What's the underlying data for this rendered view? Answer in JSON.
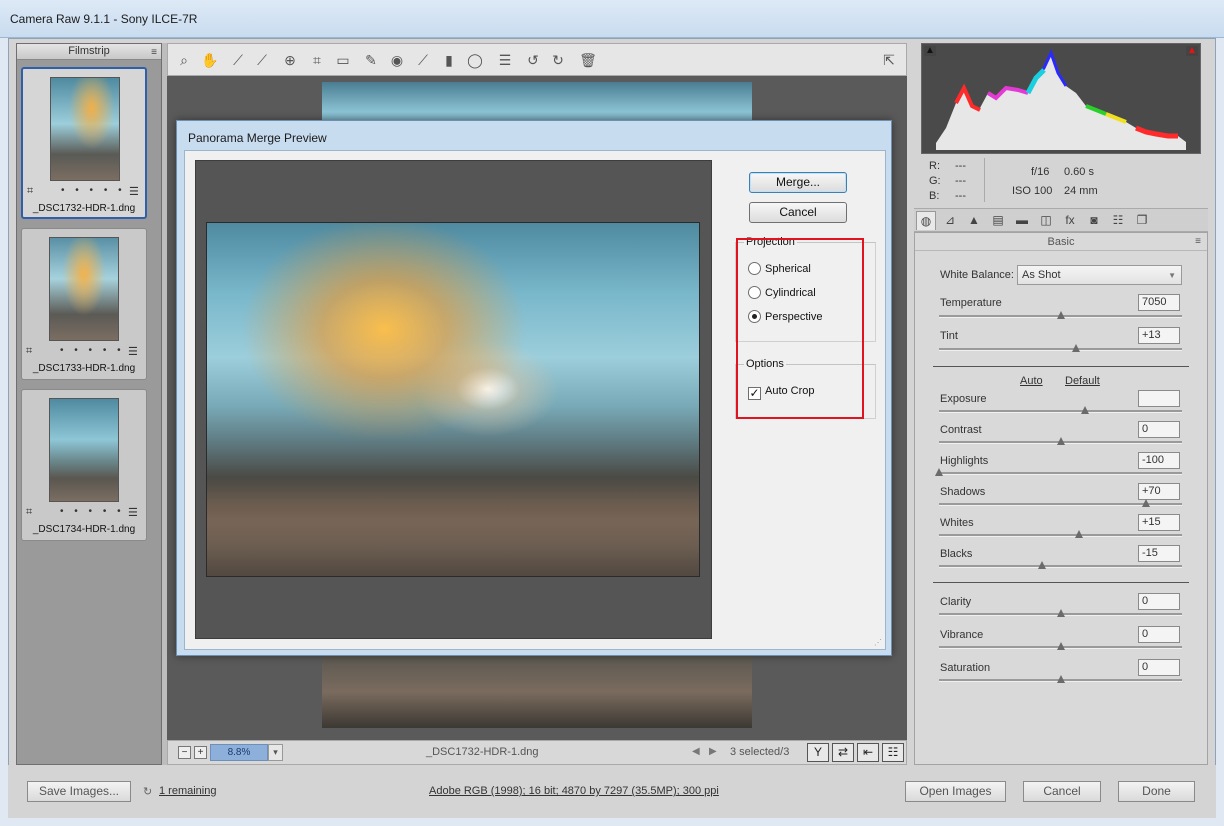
{
  "window": {
    "title": "Camera Raw 9.1.1  -  Sony ILCE-7R"
  },
  "filmstrip": {
    "header": "Filmstrip",
    "items": [
      {
        "name": "_DSC1732-HDR-1.dng",
        "dots": "• • • • •",
        "selected": true
      },
      {
        "name": "_DSC1733-HDR-1.dng",
        "dots": "• • • • •",
        "selected": false
      },
      {
        "name": "_DSC1734-HDR-1.dng",
        "dots": "• • • • •",
        "selected": false
      }
    ]
  },
  "toolbar": {
    "icons": [
      "zoom-icon",
      "hand-icon",
      "white-balance-icon",
      "color-sampler-icon",
      "target-adjust-icon",
      "crop-icon",
      "straighten-icon",
      "spot-removal-icon",
      "red-eye-icon",
      "adjustment-brush-icon",
      "graduated-filter-icon",
      "radial-filter-icon",
      "presets-list-icon",
      "rotate-left-icon",
      "rotate-right-icon",
      "trash-icon",
      "open-preferences-icon"
    ]
  },
  "statusbar": {
    "zoom": "8.8%",
    "filename": "_DSC1732-HDR-1.dng",
    "selected": "3 selected/3"
  },
  "dialog": {
    "title": "Panorama Merge Preview",
    "merge_label": "Merge...",
    "cancel_label": "Cancel",
    "projection": {
      "label": "Projection",
      "options": [
        "Spherical",
        "Cylindrical",
        "Perspective"
      ],
      "selected": "Perspective"
    },
    "options": {
      "label": "Options",
      "auto_crop": "Auto Crop",
      "auto_crop_checked": true
    }
  },
  "info": {
    "r": "R:",
    "g": "G:",
    "b": "B:",
    "r_val": "---",
    "g_val": "---",
    "b_val": "---",
    "aperture": "f/16",
    "shutter": "0.60 s",
    "iso": "ISO 100",
    "focal": "24 mm"
  },
  "panel": {
    "title": "Basic",
    "white_balance": {
      "label": "White Balance:",
      "value": "As Shot"
    },
    "temperature": {
      "label": "Temperature",
      "value": "7050",
      "level": 0.5
    },
    "tint": {
      "label": "Tint",
      "value": "+13",
      "level": 0.565
    },
    "auto_label": "Auto",
    "default_label": "Default",
    "tone": [
      {
        "label": "Exposure",
        "value": "",
        "level": 0.6
      },
      {
        "label": "Contrast",
        "value": "0",
        "level": 0.5
      },
      {
        "label": "Highlights",
        "value": "-100",
        "level": 0.0
      },
      {
        "label": "Shadows",
        "value": "+70",
        "level": 0.85
      },
      {
        "label": "Whites",
        "value": "+15",
        "level": 0.575
      },
      {
        "label": "Blacks",
        "value": "-15",
        "level": 0.425
      }
    ],
    "presence": [
      {
        "label": "Clarity",
        "value": "0",
        "level": 0.5
      },
      {
        "label": "Vibrance",
        "value": "0",
        "level": 0.5
      },
      {
        "label": "Saturation",
        "value": "0",
        "level": 0.5
      }
    ]
  },
  "bottom": {
    "save_label": "Save Images...",
    "remaining": "1 remaining",
    "workflow": "Adobe RGB (1998); 16 bit; 4870 by 7297 (35.5MP); 300 ppi",
    "open_label": "Open Images",
    "cancel_label": "Cancel",
    "done_label": "Done"
  },
  "colors": {
    "accent": "#2f5fa8",
    "highlight_box": "#e0141e",
    "dialog_frame": "#c8dcf0"
  }
}
